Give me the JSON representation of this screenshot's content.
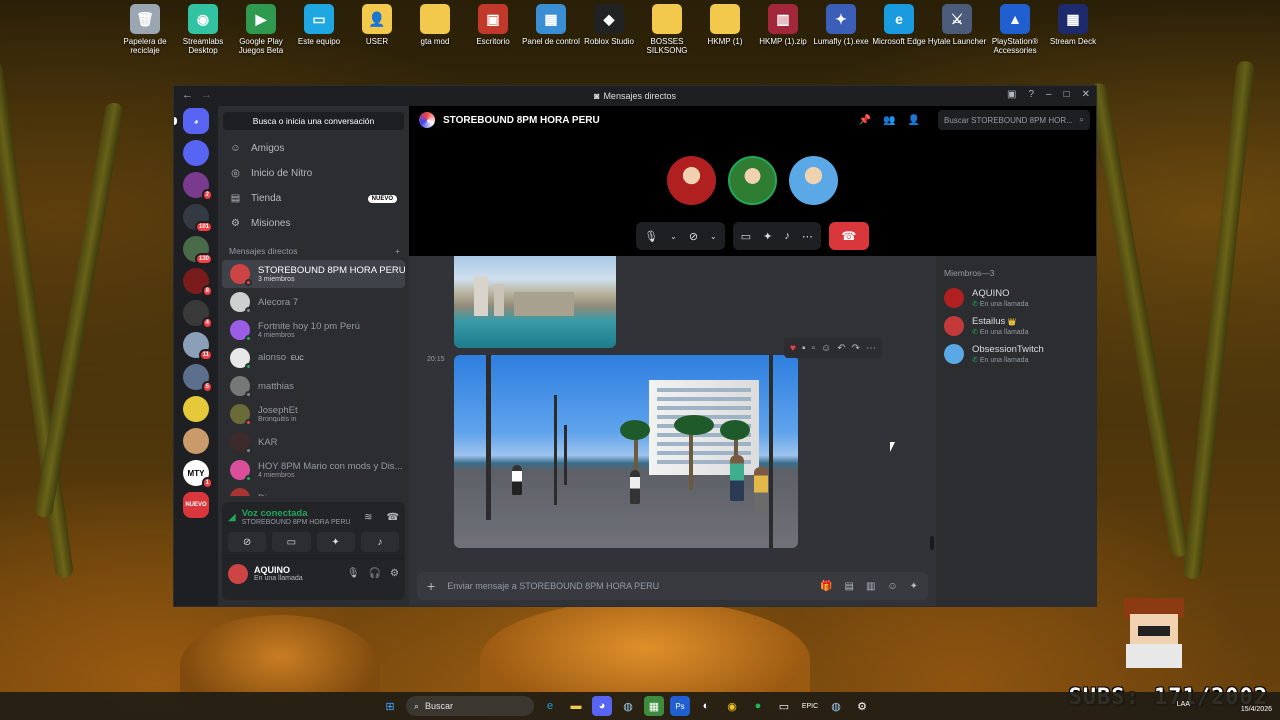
{
  "desktop": {
    "icons": [
      {
        "label": "Papelera de reciclaje",
        "icon": "recycle-bin-icon",
        "color": "#9aa7b3",
        "glyph": "🗑"
      },
      {
        "label": "Streamlabs Desktop",
        "icon": "streamlabs-icon",
        "color": "#31c3a2",
        "glyph": "◉"
      },
      {
        "label": "Google Play Juegos Beta",
        "icon": "google-play-games-icon",
        "color": "#2f9a4f",
        "glyph": "▶"
      },
      {
        "label": "Este equipo",
        "icon": "this-pc-icon",
        "color": "#1ea7e1",
        "glyph": "▭"
      },
      {
        "label": "USER",
        "icon": "user-folder-icon",
        "color": "#f2c94c",
        "glyph": "👤"
      },
      {
        "label": "gta mod",
        "icon": "folder-icon",
        "color": "#f2c94c",
        "glyph": ""
      },
      {
        "label": "Escritorio",
        "icon": "desktop-folder-icon",
        "color": "#c0392b",
        "glyph": "▣"
      },
      {
        "label": "Panel de control",
        "icon": "control-panel-icon",
        "color": "#3a8fd4",
        "glyph": "▦"
      },
      {
        "label": "Roblox Studio",
        "icon": "roblox-studio-icon",
        "color": "#222222",
        "glyph": "◆"
      },
      {
        "label": "BOSSES SILKSONG",
        "icon": "folder-icon",
        "color": "#f2c94c",
        "glyph": ""
      },
      {
        "label": "HKMP (1)",
        "icon": "folder-icon",
        "color": "#f2c94c",
        "glyph": ""
      },
      {
        "label": "HKMP (1).zip",
        "icon": "zip-archive-icon",
        "color": "#a3273b",
        "glyph": "▥"
      },
      {
        "label": "Lumafly (1).exe",
        "icon": "lumafly-icon",
        "color": "#3b5fb8",
        "glyph": "✦"
      },
      {
        "label": "Microsoft Edge",
        "icon": "edge-icon",
        "color": "#1a9be0",
        "glyph": "e"
      },
      {
        "label": "Hytale Launcher",
        "icon": "hytale-icon",
        "color": "#4a5c7a",
        "glyph": "⚔"
      },
      {
        "label": "PlayStation® Accessories",
        "icon": "playstation-icon",
        "color": "#1f5fcf",
        "glyph": "▲"
      },
      {
        "label": "Stream Deck",
        "icon": "stream-deck-icon",
        "color": "#1d2a6b",
        "glyph": "▦"
      }
    ]
  },
  "window": {
    "title": "Mensajes directos",
    "back": "←",
    "forward": "→"
  },
  "guilds": {
    "home_glyph": "◕",
    "items": [
      {
        "badge": "",
        "color": "#5865f2",
        "label": ""
      },
      {
        "badge": "2",
        "color": "#7a3b8f",
        "label": ""
      },
      {
        "badge": "101",
        "color": "#333a44",
        "label": ""
      },
      {
        "badge": "130",
        "color": "#4a6b4a",
        "label": ""
      },
      {
        "badge": "8",
        "color": "#7a1c1c",
        "label": ""
      },
      {
        "badge": "4",
        "color": "#3a3a3a",
        "label": ""
      },
      {
        "badge": "11",
        "color": "#8ba0b8",
        "label": ""
      },
      {
        "badge": "5",
        "color": "#5c6f8c",
        "label": ""
      },
      {
        "badge": "",
        "color": "#e6c93a",
        "label": ""
      },
      {
        "badge": "",
        "color": "#c99a6a",
        "label": ""
      },
      {
        "badge": "1",
        "color": "#ffffff",
        "label": "MTY"
      },
      {
        "badge": "",
        "color": "#da373c",
        "label": "NUEVO"
      }
    ]
  },
  "dm_column": {
    "search_label": "Busca o inicia una conversación",
    "nav": {
      "friends": "Amigos",
      "nitro": "Inicio de Nitro",
      "shop": "Tienda",
      "shop_badge": "NUEVO",
      "quests": "Misiones"
    },
    "section_title": "Mensajes directos",
    "add_glyph": "+",
    "dms": [
      {
        "name": "STOREBOUND 8PM HORA PERU",
        "sub": "3 miembros",
        "color": "#c44",
        "status": "#f23f43",
        "active": true
      },
      {
        "name": "Alecora 7",
        "sub": "",
        "color": "#cfcfcf",
        "status": "#80848e",
        "active": false
      },
      {
        "name": "Fortnite hoy 10 pm Perú",
        "sub": "4 miembros",
        "color": "#9b5de5",
        "status": "#23a55a",
        "active": false
      },
      {
        "name": "alonso",
        "sub": "",
        "color": "#e8e8e8",
        "status": "#23a55a",
        "active": false,
        "tag": "EUC"
      },
      {
        "name": "matthias",
        "sub": "",
        "color": "#777",
        "status": "#80848e",
        "active": false
      },
      {
        "name": "JosephEt",
        "sub": "Bronquitis in",
        "color": "#6b6b3a",
        "status": "#f23f43",
        "active": false
      },
      {
        "name": "KAR",
        "sub": "",
        "color": "#3d2b2b",
        "status": "#80848e",
        "active": false
      },
      {
        "name": "HOY 8PM Mario con mods y Dis...",
        "sub": "4 miembros",
        "color": "#d94f9a",
        "status": "#23a55a",
        "active": false
      },
      {
        "name": "Diego",
        "sub": "",
        "color": "#a33",
        "status": "#80848e",
        "active": false
      }
    ]
  },
  "voice_panel": {
    "title": "Voz conectada",
    "channel": "STOREBOUND 8PM HORA PERU",
    "user": "AQUINO",
    "user_status": "En una llamada"
  },
  "channel": {
    "name": "STOREBOUND 8PM HORA PERU",
    "search_placeholder": "Buscar STOREBOUND 8PM HOR..."
  },
  "call": {
    "participants": [
      {
        "name": "AQUINO",
        "color": "#b02020"
      },
      {
        "name": "Estailus",
        "color": "#2e7d32"
      },
      {
        "name": "ObsessionTwitch",
        "color": "#5aa9e6"
      }
    ]
  },
  "chat": {
    "timestamp": "20:15",
    "composer_placeholder": "Enviar mensaje a STOREBOUND 8PM HORA PERU"
  },
  "members": {
    "title": "Miembros—3",
    "list": [
      {
        "name": "AQUINO",
        "status": "En una llamada",
        "color": "#b02020",
        "crown": ""
      },
      {
        "name": "Estailus",
        "status": "En una llamada",
        "color": "#c43a3a",
        "crown": "👑"
      },
      {
        "name": "ObsessionTwitch",
        "status": "En una llamada",
        "color": "#5aa9e6",
        "crown": ""
      }
    ]
  },
  "taskbar": {
    "search_label": "Buscar",
    "lang": "LAA",
    "date": "15/4/2026"
  },
  "overlay": {
    "subs": "SUBS: 171/2002"
  }
}
